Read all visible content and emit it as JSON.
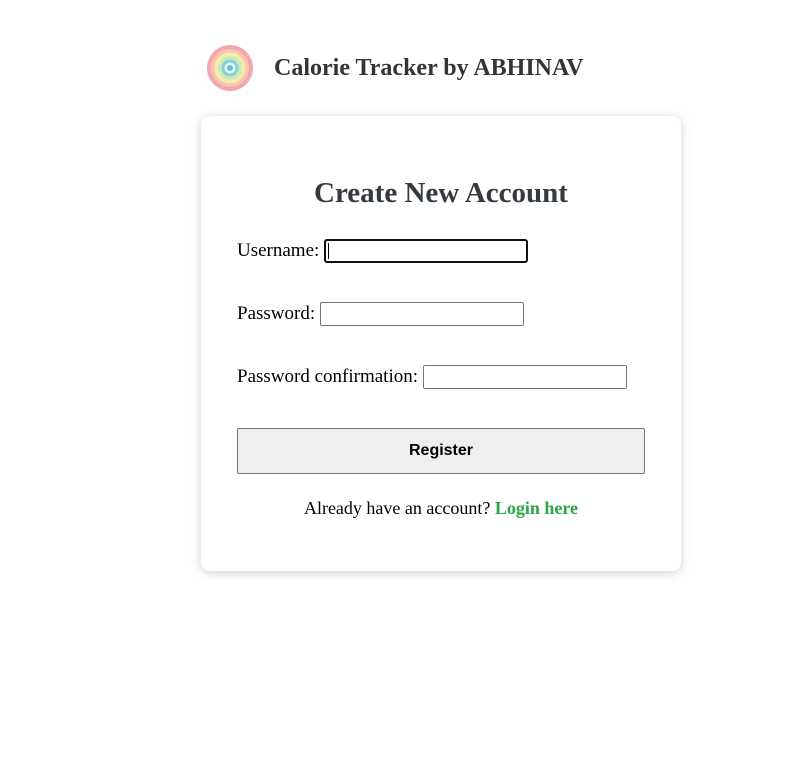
{
  "header": {
    "logo_icon": "concentric-rings-logo-icon",
    "title": "Calorie Tracker by ABHINAV"
  },
  "form": {
    "title": "Create New Account",
    "fields": [
      {
        "label": "Username:",
        "value": "",
        "focused": true
      },
      {
        "label": "Password:",
        "value": "",
        "focused": false
      },
      {
        "label": "Password confirmation:",
        "value": "",
        "focused": false
      }
    ],
    "submit_label": "Register",
    "login_prompt": "Already have an account?",
    "login_link": "Login here"
  },
  "colors": {
    "link": "#28a745",
    "title": "#343a40",
    "button_bg": "#efefef"
  }
}
